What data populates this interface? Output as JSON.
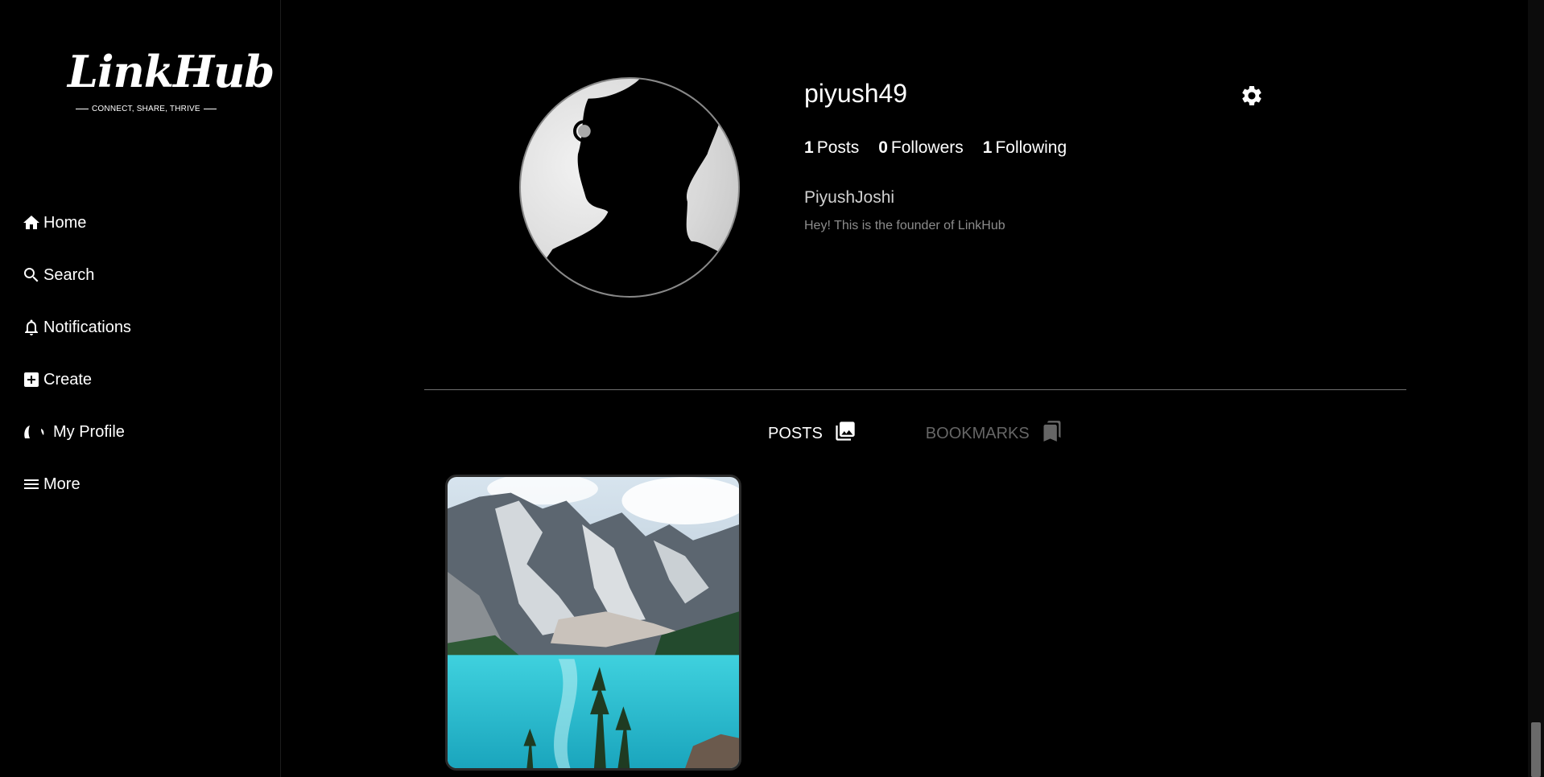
{
  "brand": {
    "logo_text": "LinkHub",
    "tagline": "CONNECT, SHARE, THRIVE"
  },
  "sidebar": {
    "items": [
      {
        "label": "Home",
        "icon": "home-icon"
      },
      {
        "label": "Search",
        "icon": "search-icon"
      },
      {
        "label": "Notifications",
        "icon": "bell-icon"
      },
      {
        "label": "Create",
        "icon": "plus-box-icon"
      },
      {
        "label": "My Profile",
        "icon": "profile-avatar-icon"
      },
      {
        "label": "More",
        "icon": "hamburger-icon"
      }
    ]
  },
  "profile": {
    "username": "piyush49",
    "stats": {
      "posts_count": "1",
      "posts_label": "Posts",
      "followers_count": "0",
      "followers_label": "Followers",
      "following_count": "1",
      "following_label": "Following"
    },
    "full_name": "PiyushJoshi",
    "bio": "Hey! This is the founder of LinkHub"
  },
  "tabs": [
    {
      "label": "POSTS",
      "icon": "images-icon",
      "active": true
    },
    {
      "label": "BOOKMARKS",
      "icon": "bookmarks-icon",
      "active": false
    }
  ],
  "colors": {
    "background": "#000000",
    "text": "#ffffff",
    "muted": "#8c8c8c",
    "inactive_tab": "#666666",
    "lake": "#2ec4d6"
  }
}
